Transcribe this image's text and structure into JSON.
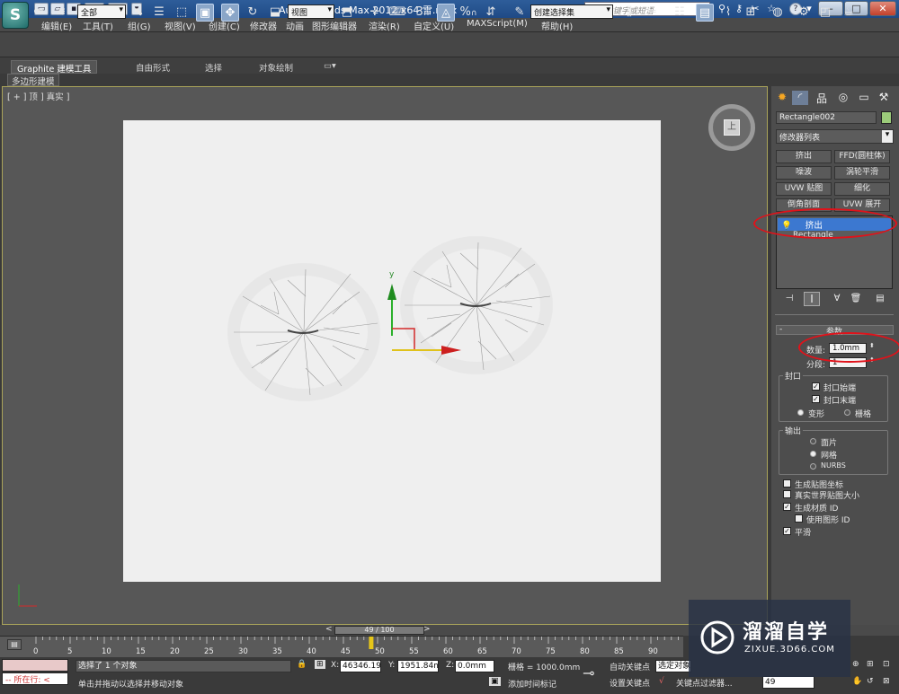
{
  "app": {
    "title": "Autodesk 3ds Max  2012 x64       雪.max",
    "search_placeholder": "键入关键字或短语",
    "logo_letter": "S"
  },
  "window_buttons": [
    "–",
    "□",
    "✕"
  ],
  "menus": [
    "编辑(E)",
    "工具(T)",
    "组(G)",
    "视图(V)",
    "创建(C)",
    "修改器",
    "动画",
    "图形编辑器",
    "渲染(R)",
    "自定义(U)",
    "MAXScript(M)",
    "帮助(H)"
  ],
  "toolbar": {
    "selection_filter": "全部",
    "reference_coord": "视图",
    "named_selection": "创建选择集",
    "snap_label": "3",
    "percent_snap": "%"
  },
  "ribbon": {
    "tabs": [
      "Graphite 建模工具",
      "自由形式",
      "选择",
      "对象绘制"
    ],
    "subtab": "多边形建模"
  },
  "viewport": {
    "label": "[ + ] 顶 ] 真实 ]",
    "axis_y": "y",
    "viewcube_face": "上"
  },
  "panel": {
    "object_name": "Rectangle002",
    "object_color": "#9ccc7a",
    "modifier_list": "修改器列表",
    "modifier_buttons": [
      "挤出",
      "FFD(圆柱体)",
      "噪波",
      "涡轮平滑",
      "UVW 贴图",
      "细化",
      "倒角剖面",
      "UVW 展开"
    ],
    "stack_items": [
      "挤出",
      "Rectangle"
    ],
    "rollout_title": "参数",
    "amount_label": "数量:",
    "amount_value": "1.0mm",
    "segments_label": "分段:",
    "segments_value": "1",
    "capping_title": "封口",
    "cap_start": "封口始端",
    "cap_end": "封口末端",
    "morph": "变形",
    "grid": "栅格",
    "output_title": "输出",
    "out_patch": "面片",
    "out_mesh": "网格",
    "out_nurbs": "NURBS",
    "gen_mapping": "生成贴图坐标",
    "real_world": "真实世界贴图大小",
    "gen_matid": "生成材质 ID",
    "use_shape_ids": "使用图形 ID",
    "smooth": "平滑"
  },
  "timeline": {
    "frame": "49 / 100",
    "ticks": [
      "0",
      "5",
      "10",
      "15",
      "20",
      "25",
      "30",
      "35",
      "40",
      "45",
      "50",
      "55",
      "60",
      "65",
      "70",
      "75",
      "80",
      "85",
      "90"
    ],
    "current_frame": 49
  },
  "status": {
    "maxscript": "所在行:",
    "selected": "选择了 1 个对象",
    "prompt": "单击并拖动以选择并移动对象",
    "x_label": "X:",
    "x_value": "46346.199",
    "y_label": "Y:",
    "y_value": "1951.84mm",
    "z_label": "Z:",
    "z_value": "0.0mm",
    "grid": "栅格 = 1000.0mm",
    "add_time_tag": "添加时间标记",
    "auto_key": "自动关键点",
    "selected_obj": "选定对象",
    "set_key": "设置关键点",
    "key_filters": "关键点过滤器...",
    "frame_field": "49"
  },
  "watermark": {
    "brand": "溜溜自学",
    "url": "ZIXUE.3D66.COM"
  }
}
